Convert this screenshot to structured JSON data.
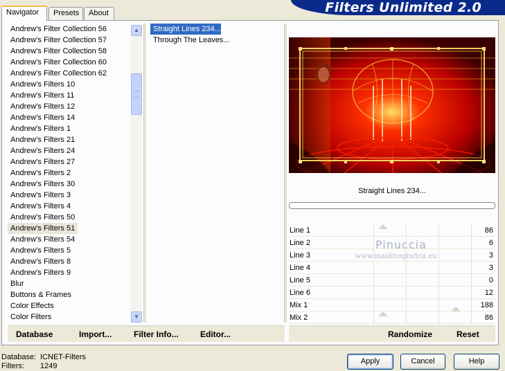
{
  "app": {
    "title": "Filters Unlimited 2.0"
  },
  "tabs": [
    {
      "label": "Navigator",
      "active": true
    },
    {
      "label": "Presets",
      "active": false
    },
    {
      "label": "About",
      "active": false
    }
  ],
  "categories": {
    "selected": "Andrew's Filters 51",
    "items": [
      "Andrew's Filter Collection 56",
      "Andrew's Filter Collection 57",
      "Andrew's Filter Collection 58",
      "Andrew's Filter Collection 60",
      "Andrew's Filter Collection 62",
      "Andrew's Filters 10",
      "Andrew's Filters 11",
      "Andrew's Filters 12",
      "Andrew's Filters 14",
      "Andrew's Filters 1",
      "Andrew's Filters 21",
      "Andrew's Filters 24",
      "Andrew's Filters 27",
      "Andrew's Filters 2",
      "Andrew's Filters 30",
      "Andrew's Filters 3",
      "Andrew's Filters 4",
      "Andrew's Filters 50",
      "Andrew's Filters 51",
      "Andrew's Filters 54",
      "Andrew's Filters 5",
      "Andrew's Filters 8",
      "Andrew's Filters 9",
      "Blur",
      "Buttons & Frames",
      "Color Effects",
      "Color Filters"
    ]
  },
  "filters": {
    "selected": "Straight Lines 234...",
    "items": [
      "Straight Lines 234...",
      "Through The Leaves..."
    ]
  },
  "preview": {
    "filter_name": "Straight Lines 234...",
    "progress": 0
  },
  "params": [
    {
      "label": "Line 1",
      "value": "86"
    },
    {
      "label": "Line 2",
      "value": "6"
    },
    {
      "label": "Line 3",
      "value": "3"
    },
    {
      "label": "Line 4",
      "value": "3"
    },
    {
      "label": "Line 5",
      "value": "0"
    },
    {
      "label": "Line 6",
      "value": "12"
    },
    {
      "label": "Mix 1",
      "value": "188"
    },
    {
      "label": "Mix 2",
      "value": "86"
    }
  ],
  "watermark": {
    "name": "Pinuccia",
    "url": "www.maidiregrafica.eu"
  },
  "toolbar": {
    "database": "Database",
    "import": "Import...",
    "filter_info": "Filter Info...",
    "editor": "Editor...",
    "randomize": "Randomize",
    "reset": "Reset"
  },
  "status": {
    "database_label": "Database:",
    "database_value": "ICNET-Filters",
    "filters_label": "Filters:",
    "filters_value": "1249"
  },
  "buttons": {
    "apply": "Apply",
    "cancel": "Cancel",
    "help": "Help"
  },
  "colors": {
    "selection": "#316ac5",
    "brand": "#0a2a8a",
    "preview_red": "#d40000",
    "preview_gold": "#e8c030"
  }
}
